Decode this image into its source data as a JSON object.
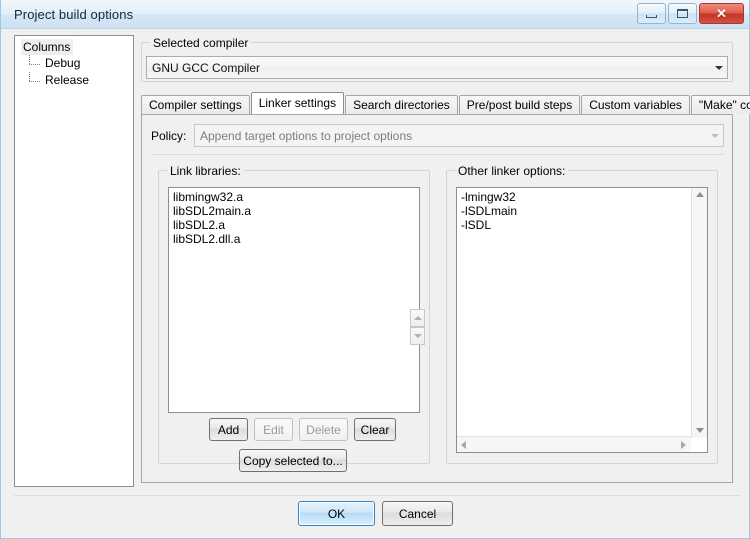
{
  "window": {
    "title": "Project build options",
    "controls": {
      "minimize": "minimize",
      "restore": "restore",
      "close": "✕"
    }
  },
  "tree": {
    "root": "Columns",
    "children": [
      "Debug",
      "Release"
    ]
  },
  "compiler_group": {
    "legend": "Selected compiler",
    "selected": "GNU GCC Compiler"
  },
  "tabs": [
    {
      "label": "Compiler settings",
      "active": false
    },
    {
      "label": "Linker settings",
      "active": true
    },
    {
      "label": "Search directories",
      "active": false
    },
    {
      "label": "Pre/post build steps",
      "active": false
    },
    {
      "label": "Custom variables",
      "active": false
    },
    {
      "label": "\"Make\" commands",
      "active": false
    }
  ],
  "policy": {
    "label": "Policy:",
    "value": "Append target options to project options",
    "disabled": true
  },
  "link_libraries": {
    "legend": "Link libraries:",
    "items": [
      "libmingw32.a",
      "libSDL2main.a",
      "libSDL2.a",
      "libSDL2.dll.a"
    ],
    "buttons": [
      {
        "label": "Add",
        "enabled": true
      },
      {
        "label": "Edit",
        "enabled": false
      },
      {
        "label": "Delete",
        "enabled": false
      },
      {
        "label": "Clear",
        "enabled": true
      }
    ],
    "copy_button": "Copy selected to..."
  },
  "other_linker_options": {
    "legend": "Other linker options:",
    "text_lines": [
      "-lmingw32",
      "-lSDLmain",
      "-lSDL"
    ]
  },
  "dialog_buttons": {
    "ok": "OK",
    "cancel": "Cancel"
  },
  "colors": {
    "dialog_bg": "#f0f0f0",
    "titlebar_start": "#f2f7fb",
    "titlebar_end": "#cfe2f2",
    "close_button": "#c43425",
    "default_button_border": "#2f84c4",
    "window_border": "#9ec7e8",
    "field_border": "#8e8e8e",
    "text": "#000000",
    "disabled_text": "#9a9a9a"
  }
}
